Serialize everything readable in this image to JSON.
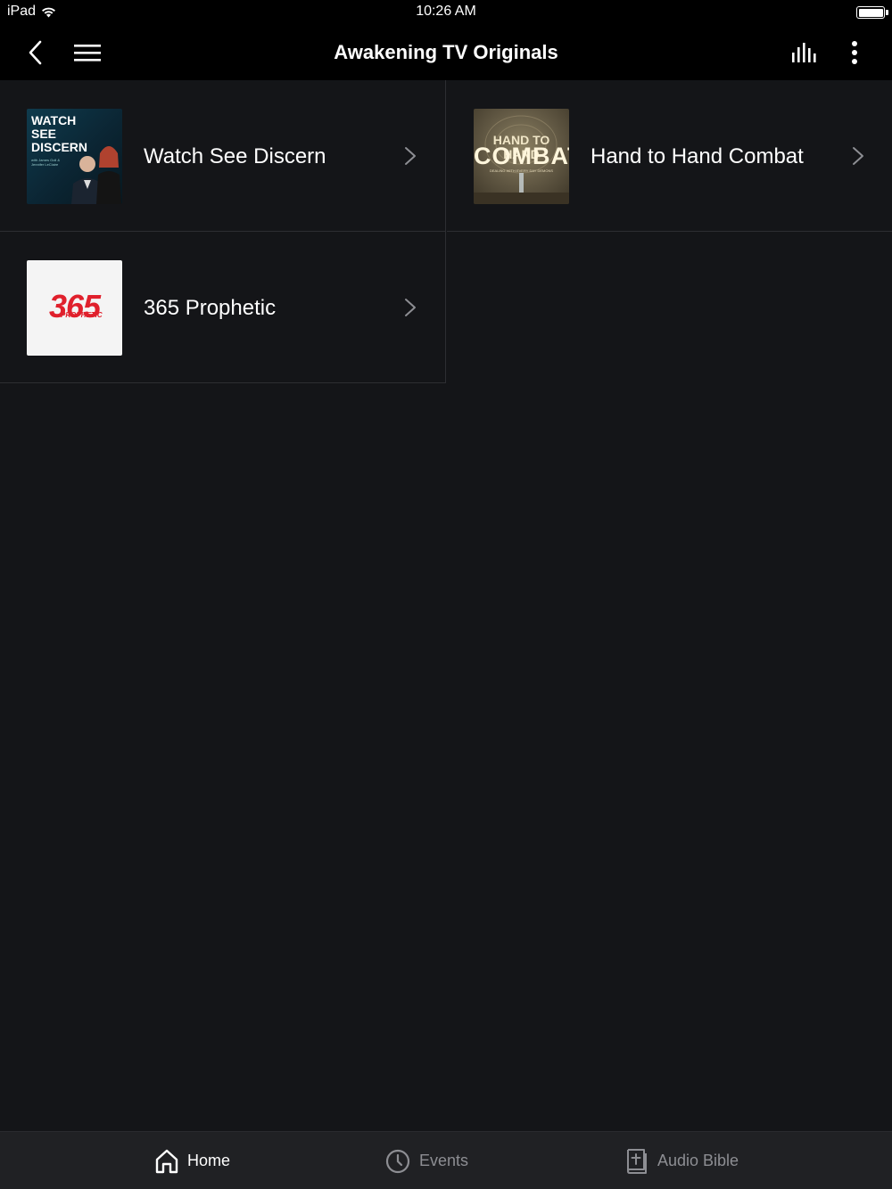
{
  "status_bar": {
    "device": "iPad",
    "time": "10:26 AM",
    "battery_level": 1.0
  },
  "nav": {
    "title": "Awakening TV Originals",
    "icons": [
      "back-chevron-icon",
      "hamburger-menu-icon",
      "equalizer-icon",
      "more-vertical-icon"
    ]
  },
  "items": [
    {
      "label": "Watch See Discern",
      "thumb_text": "WATCH SEE DISCERN",
      "thumb_subtext": "with James Goll & Jennifer LeClaire"
    },
    {
      "label": "Hand to Hand Combat",
      "thumb_text_top": "HAND TO HAND",
      "thumb_text_main": "COMBAT",
      "thumb_text_sub": "DEALING WITH EVERY DAY DEMONS"
    },
    {
      "label": "365 Prophetic",
      "thumb_text_num": "365",
      "thumb_text_sub": "PROPHETIC"
    }
  ],
  "tabs": [
    {
      "label": "Home",
      "icon": "home-icon",
      "active": true
    },
    {
      "label": "Events",
      "icon": "clock-icon",
      "active": false
    },
    {
      "label": "Audio Bible",
      "icon": "bible-icon",
      "active": false
    }
  ],
  "colors": {
    "background": "#141518",
    "bar": "#000000",
    "tab_bar": "#202124",
    "active_tab": "#ffffff",
    "inactive_tab": "#8d8e93",
    "brand_red": "#e0202c"
  }
}
